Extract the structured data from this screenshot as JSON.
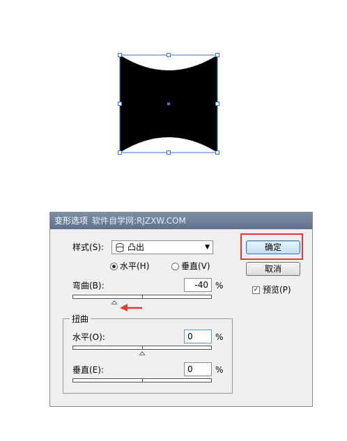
{
  "dialog": {
    "title": "变形选项",
    "watermark": "软件自学网:RJZXW.COM",
    "style_label": "样式(S):",
    "style_value": "凸出",
    "orientation": {
      "horizontal_label": "水平(H)",
      "vertical_label": "垂直(V)",
      "selected": "horizontal"
    },
    "bend_label": "弯曲(B):",
    "bend_value": "-40",
    "percent": "%",
    "bend_level": -40,
    "distortion": {
      "title": "扭曲",
      "horizontal_label": "水平(O):",
      "horizontal_value": "0",
      "horizontal_level": 0,
      "vertical_label": "垂直(E):",
      "vertical_value": "0"
    },
    "ok_label": "确定",
    "cancel_label": "取消",
    "preview_label": "预览(P)",
    "preview_checked": true
  },
  "colors": {
    "highlight": "#e03b3b",
    "selection": "#3b6fd6",
    "annotation_arrow": "#e03b3b"
  },
  "icons": [
    "convex-shape-icon",
    "dropdown-caret-icon",
    "red-arrow-icon"
  ]
}
